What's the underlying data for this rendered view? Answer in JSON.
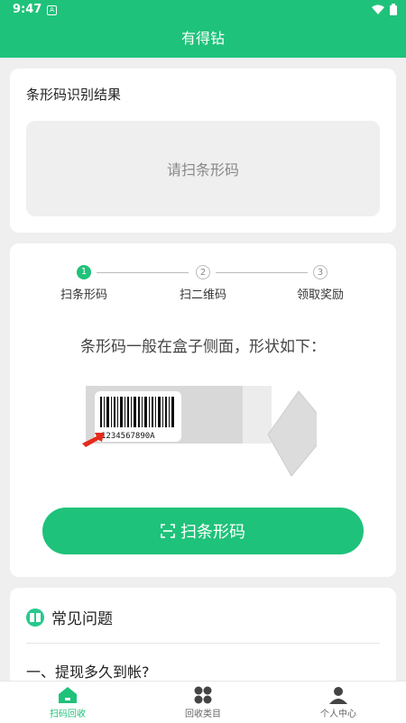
{
  "status": {
    "time": "9:47"
  },
  "app": {
    "title": "有得钻",
    "accent": "#1fc27a"
  },
  "result": {
    "title": "条形码识别结果",
    "placeholder": "请扫条形码"
  },
  "steps": [
    {
      "num": "1",
      "label": "扫条形码"
    },
    {
      "num": "2",
      "label": "扫二维码"
    },
    {
      "num": "3",
      "label": "领取奖励"
    }
  ],
  "hint": "条形码一般在盒子侧面，形状如下：",
  "barcode_text": "1234567890A",
  "scan_button": "扫条形码",
  "faq": {
    "title": "常见问题",
    "q1": "一、提现多久到帐?"
  },
  "tabs": [
    {
      "label": "扫码回收",
      "icon": "home-icon"
    },
    {
      "label": "回收类目",
      "icon": "category-icon"
    },
    {
      "label": "个人中心",
      "icon": "person-icon"
    }
  ]
}
